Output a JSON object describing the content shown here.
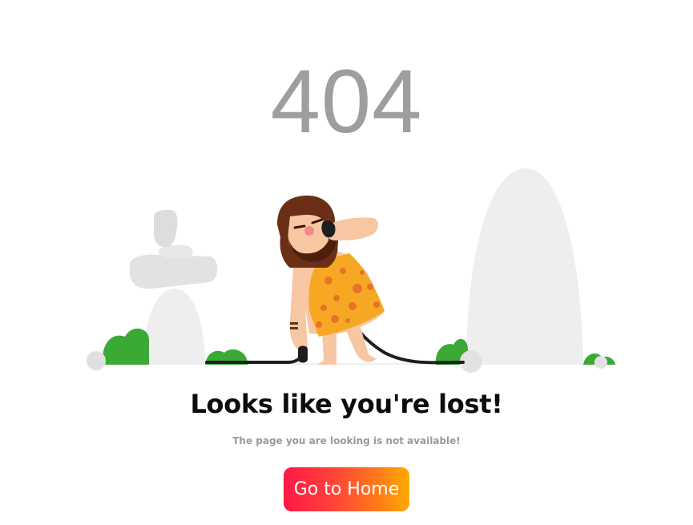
{
  "error": {
    "code": "404",
    "headline": "Looks like you're lost!",
    "message": "The page you are looking is not available!"
  },
  "actions": {
    "home_label": "Go to Home"
  },
  "colors": {
    "code_text": "#9e9e9e",
    "headline_text": "#0d0d0d",
    "message_text": "#9a9a9a",
    "rock": "#eeeeee",
    "bush": "#3aaa35",
    "button_gradient_start": "#ff1744",
    "button_gradient_end": "#ffab00"
  },
  "illustration": {
    "subject": "caveman-with-unplugged-cable",
    "icons": [
      "rock-stack-icon",
      "tall-rock-icon",
      "bush-icon",
      "caveman-icon",
      "cable-icon",
      "plug-icon"
    ]
  }
}
